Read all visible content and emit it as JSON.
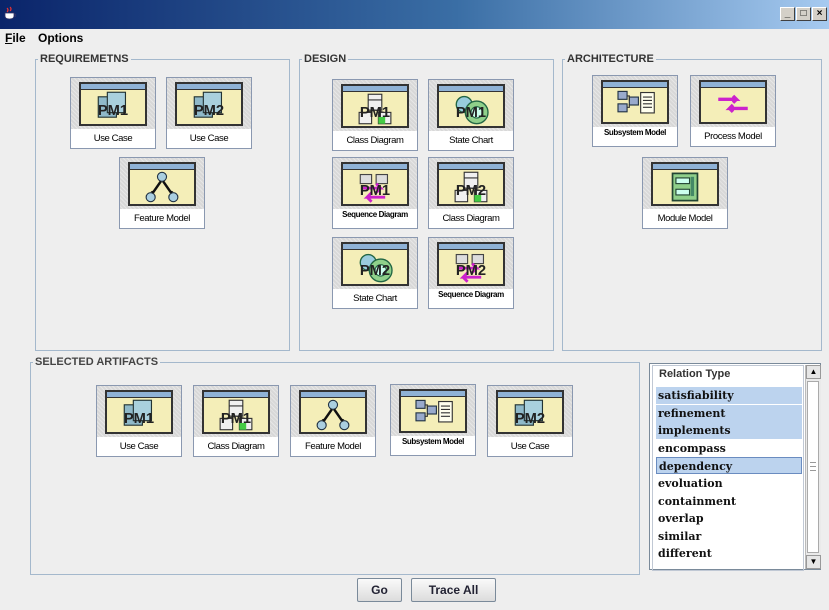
{
  "window": {
    "icon": "java-cup-icon",
    "controls": [
      "_",
      "□",
      "×"
    ]
  },
  "menu": {
    "items": [
      "File",
      "Options"
    ]
  },
  "panels": {
    "requirements": {
      "title": "REQUIREMETNS",
      "artifacts": [
        {
          "label": "Use Case",
          "pm": "PM1",
          "icon": "use-case-icon"
        },
        {
          "label": "Use Case",
          "pm": "PM2",
          "icon": "use-case-icon"
        },
        {
          "label": "Feature Model",
          "icon": "feature-model-icon"
        }
      ]
    },
    "design": {
      "title": "DESIGN",
      "artifacts": [
        {
          "label": "Class Diagram",
          "pm": "PM1",
          "icon": "class-diagram-icon"
        },
        {
          "label": "State Chart",
          "pm": "PM1",
          "icon": "state-chart-icon"
        },
        {
          "label": "Sequence Diagram",
          "pm": "PM1",
          "icon": "sequence-diagram-icon"
        },
        {
          "label": "Class Diagram",
          "pm": "PM2",
          "icon": "class-diagram-icon"
        },
        {
          "label": "State Chart",
          "pm": "PM2",
          "icon": "state-chart-icon"
        },
        {
          "label": "Sequence Diagram",
          "pm": "PM2",
          "icon": "sequence-diagram-icon"
        }
      ]
    },
    "architecture": {
      "title": "ARCHITECTURE",
      "artifacts": [
        {
          "label": "Subsystem Model",
          "icon": "subsystem-model-icon"
        },
        {
          "label": "Process Model",
          "icon": "process-model-icon"
        },
        {
          "label": "Module Model",
          "icon": "module-model-icon"
        }
      ]
    },
    "selected": {
      "title": "SELECTED ARTIFACTS",
      "artifacts": [
        {
          "label": "Use Case",
          "pm": "PM1",
          "icon": "use-case-icon"
        },
        {
          "label": "Class Diagram",
          "pm": "PM1",
          "icon": "class-diagram-icon"
        },
        {
          "label": "Feature Model",
          "icon": "feature-model-icon"
        },
        {
          "label": "Subsystem Model",
          "icon": "subsystem-model-icon"
        },
        {
          "label": "Use Case",
          "pm": "PM2",
          "icon": "use-case-icon"
        }
      ]
    }
  },
  "relation_type": {
    "title": "Relation Type",
    "items": [
      {
        "label": "satisfiability",
        "selected": true
      },
      {
        "label": "refinement",
        "selected": true
      },
      {
        "label": "implements",
        "selected": true
      },
      {
        "label": "encompass",
        "selected": false
      },
      {
        "label": "dependency",
        "selected": true,
        "focused": true
      },
      {
        "label": "evoluation",
        "selected": false
      },
      {
        "label": "containment",
        "selected": false
      },
      {
        "label": "overlap",
        "selected": false
      },
      {
        "label": "similar",
        "selected": false
      },
      {
        "label": "different",
        "selected": false
      }
    ]
  },
  "buttons": {
    "go": "Go",
    "trace_all": "Trace All"
  },
  "colors": {
    "selection": "#bcd3ee",
    "panel_border": "#a4b8cc",
    "title_bar": "#0a246a"
  }
}
